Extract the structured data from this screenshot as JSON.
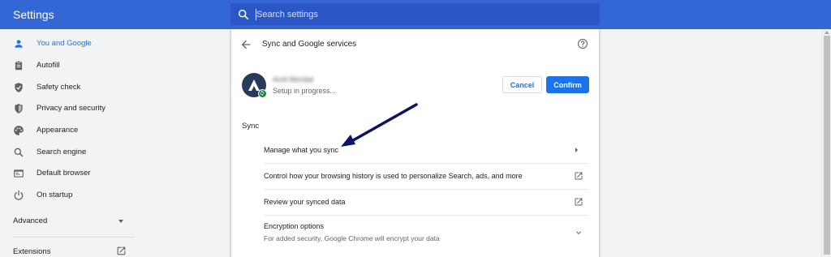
{
  "app": {
    "title": "Settings"
  },
  "search": {
    "placeholder": "Search settings",
    "value": ""
  },
  "sidebar": {
    "items": [
      {
        "label": "You and Google",
        "icon": "person-icon",
        "active": true
      },
      {
        "label": "Autofill",
        "icon": "clipboard-icon",
        "active": false
      },
      {
        "label": "Safety check",
        "icon": "shield-check-icon",
        "active": false
      },
      {
        "label": "Privacy and security",
        "icon": "shield-icon",
        "active": false
      },
      {
        "label": "Appearance",
        "icon": "palette-icon",
        "active": false
      },
      {
        "label": "Search engine",
        "icon": "search-icon",
        "active": false
      },
      {
        "label": "Default browser",
        "icon": "browser-icon",
        "active": false
      },
      {
        "label": "On startup",
        "icon": "power-icon",
        "active": false
      }
    ],
    "advanced_label": "Advanced",
    "extensions_label": "Extensions"
  },
  "page": {
    "title": "Sync and Google services",
    "account": {
      "name": "Amit Mondal",
      "status": "Setup in progress..."
    },
    "buttons": {
      "cancel": "Cancel",
      "confirm": "Confirm"
    },
    "section_title": "Sync",
    "rows": [
      {
        "label": "Manage what you sync",
        "icon": "chevron-right-icon"
      },
      {
        "label": "Control how your browsing history is used to personalize Search, ads, and more",
        "icon": "open-in-new-icon"
      },
      {
        "label": "Review your synced data",
        "icon": "open-in-new-icon"
      },
      {
        "label": "Encryption options",
        "sublabel": "For added security, Google Chrome will encrypt your data",
        "icon": "chevron-down-icon"
      }
    ]
  },
  "colors": {
    "header": "#3367d6",
    "search_bg": "#2a56c6",
    "accent": "#1a73e8",
    "annotation_arrow": "#0d1466"
  }
}
